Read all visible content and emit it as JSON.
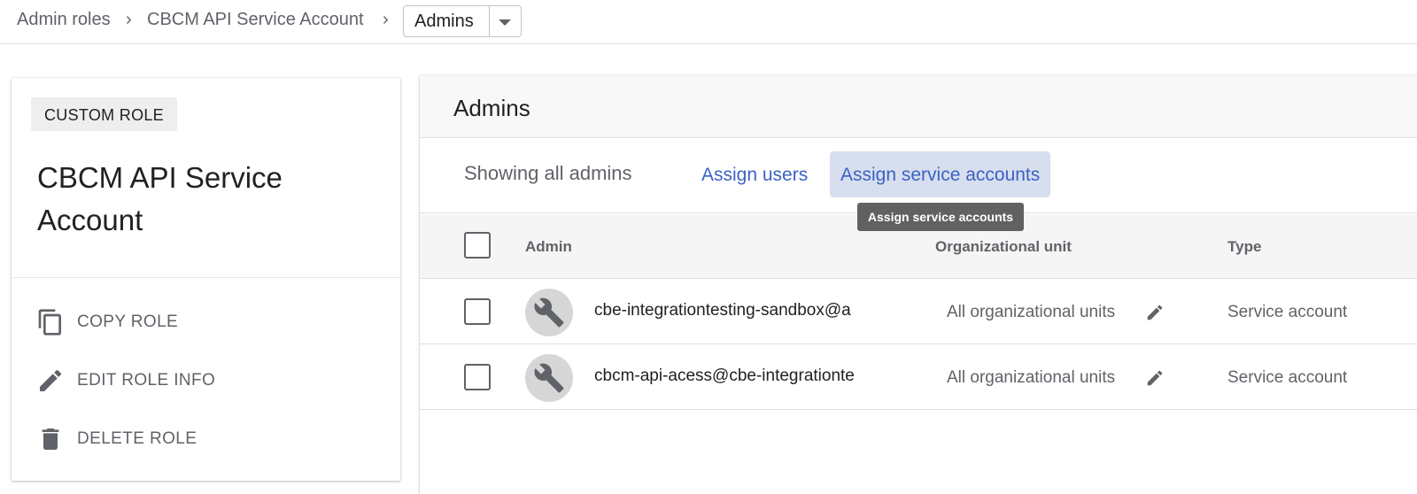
{
  "breadcrumb": {
    "items": [
      "Admin roles",
      "CBCM API Service Account"
    ],
    "separator": "›",
    "current": "Admins"
  },
  "role": {
    "chip": "CUSTOM ROLE",
    "title": "CBCM API Service Account",
    "actions": [
      {
        "label": "COPY ROLE",
        "icon": "copy-icon"
      },
      {
        "label": "EDIT ROLE INFO",
        "icon": "pencil-icon"
      },
      {
        "label": "DELETE ROLE",
        "icon": "trash-icon"
      }
    ]
  },
  "admins_panel": {
    "title": "Admins",
    "showing": "Showing all admins",
    "assign_users": "Assign users",
    "assign_service_accounts": "Assign service accounts",
    "tooltip": "Assign service accounts",
    "columns": [
      "Admin",
      "Organizational unit",
      "Type"
    ],
    "rows": [
      {
        "admin": "cbe-integrationtesting-sandbox@a",
        "ou": "All organizational units",
        "type": "Service account",
        "icon": "wrench-icon"
      },
      {
        "admin": "cbcm-api-acess@cbe-integrationte",
        "ou": "All organizational units",
        "type": "Service account",
        "icon": "wrench-icon"
      }
    ]
  },
  "colors": {
    "link": "#3b62c5",
    "active_button_bg": "#d7deee",
    "tooltip_bg": "#616161",
    "muted_text": "#5f6368"
  }
}
